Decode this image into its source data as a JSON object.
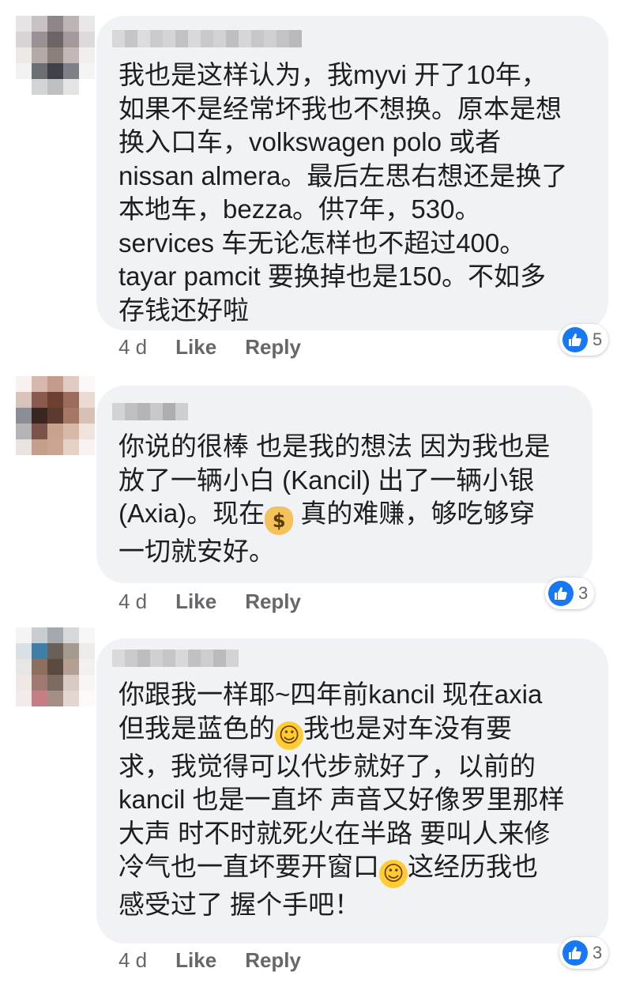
{
  "comments": [
    {
      "text": "我也是这样认为，我myvi 开了10年，\n如果不是经常坏我也不想换。原本是想\n换入口车，volkswagen polo 或者\nnissan almera。最后左思右想还是换了\n本地车，bezza。供7年，530。\nservices 车无论怎样也不超过400。\ntayar pamcit 要换掉也是150。不如多\n存钱还好啦",
      "time": "4 d",
      "like_label": "Like",
      "reply_label": "Reply",
      "reaction_count": "5"
    },
    {
      "text_before_emoji": "你说的很棒 也是我的想法 因为我也是\n放了一辆小白 (Kancil) 出了一辆小银\n(Axia)。现在",
      "emoji": "money-bag",
      "text_after_emoji": " 真的难赚，够吃够穿\n一切就安好。",
      "time": "4 d",
      "like_label": "Like",
      "reply_label": "Reply",
      "reaction_count": "3"
    },
    {
      "text_part1": "你跟我一样耶~四年前kancil 现在axia\n但我是蓝色的",
      "emoji1": "grinning-face",
      "text_part2": "我也是对车没有要\n求，我觉得可以代步就好了，以前的\nkancil 也是一直坏 声音又好像罗里那样\n大声 时不时就死火在半路 要叫人来修\n冷气也一直坏要开窗口",
      "emoji2": "sweat-smile-face",
      "text_part3": "这经历我也\n感受过了 握个手吧！",
      "time": "4 d",
      "like_label": "Like",
      "reply_label": "Reply",
      "reaction_count": "3"
    }
  ],
  "colors": {
    "bubble": "#f0f2f5",
    "like_blue": "#1877f2",
    "meta_gray": "#65676b",
    "text": "#1c1e21"
  }
}
